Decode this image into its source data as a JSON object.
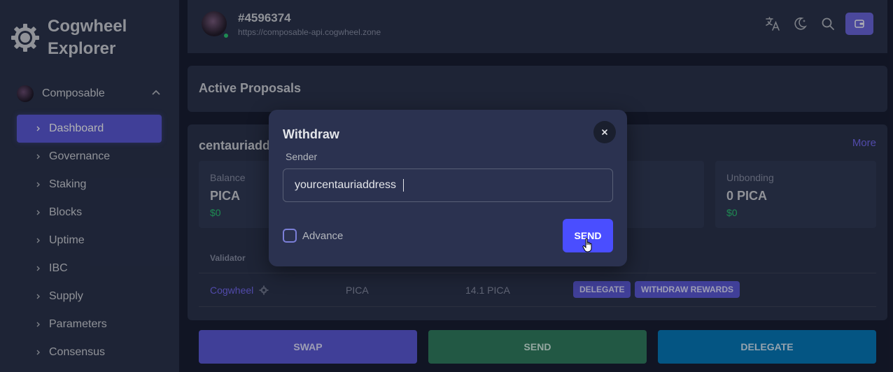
{
  "sidebar": {
    "brand": "Cogwheel Explorer",
    "chain": "Composable",
    "items": [
      {
        "label": "Dashboard"
      },
      {
        "label": "Governance"
      },
      {
        "label": "Staking"
      },
      {
        "label": "Blocks"
      },
      {
        "label": "Uptime"
      },
      {
        "label": "IBC"
      },
      {
        "label": "Supply"
      },
      {
        "label": "Parameters"
      },
      {
        "label": "Consensus"
      }
    ]
  },
  "navbar": {
    "block_height": "#4596374",
    "endpoint": "https://composable-api.cogwheel.zone",
    "icons": [
      "translate-icon",
      "dark-mode-icon",
      "search-icon",
      "wallet-icon"
    ]
  },
  "proposals": {
    "title": "Active Proposals"
  },
  "account": {
    "title": "centauriadd",
    "more_label": "More",
    "stats": [
      {
        "label": "Balance",
        "value": "PICA",
        "usd": "$0"
      },
      {
        "label": "Unbonding",
        "value": "0 PICA",
        "usd": "$0"
      }
    ],
    "table": {
      "headers": [
        "Validator"
      ],
      "rows": [
        {
          "validator": "Cogwheel",
          "token": "PICA",
          "amount": "14.1 PICA",
          "actions": [
            "DELEGATE",
            "WITHDRAW REWARDS"
          ]
        }
      ]
    }
  },
  "actions": {
    "swap": "SWAP",
    "send": "SEND",
    "delegate": "DELEGATE"
  },
  "modal": {
    "title": "Withdraw",
    "close_symbol": "×",
    "sender_label": "Sender",
    "sender_value": "yourcentauriaddress",
    "advance_label": "Advance",
    "advance_checked": false,
    "submit_label": "SEND"
  },
  "colors": {
    "primary": "#5a57d6",
    "success": "#28c76f",
    "send_green": "#2e7d5b",
    "delegate_blue": "#0278b7",
    "modal_send": "#4a4eff"
  }
}
